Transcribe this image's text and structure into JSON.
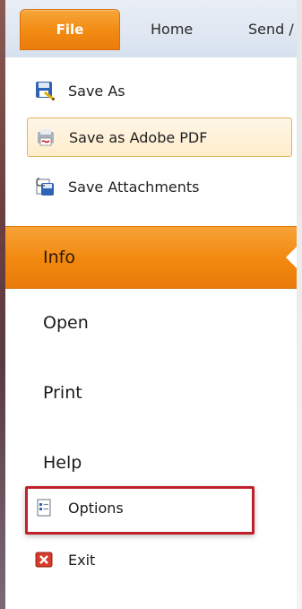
{
  "tabs": {
    "file": "File",
    "home": "Home",
    "send": "Send /"
  },
  "quick_actions": [
    {
      "label": "Save As",
      "icon": "save-as-icon"
    },
    {
      "label": "Save as Adobe PDF",
      "icon": "adobe-pdf-icon",
      "highlighted": true
    },
    {
      "label": "Save Attachments",
      "icon": "save-attachments-icon"
    }
  ],
  "nav": {
    "info": "Info",
    "open": "Open",
    "print": "Print",
    "help": "Help"
  },
  "bottom_actions": {
    "options": "Options",
    "exit": "Exit"
  },
  "colors": {
    "accent_orange": "#f28a12",
    "highlight_red": "#c0222c"
  }
}
